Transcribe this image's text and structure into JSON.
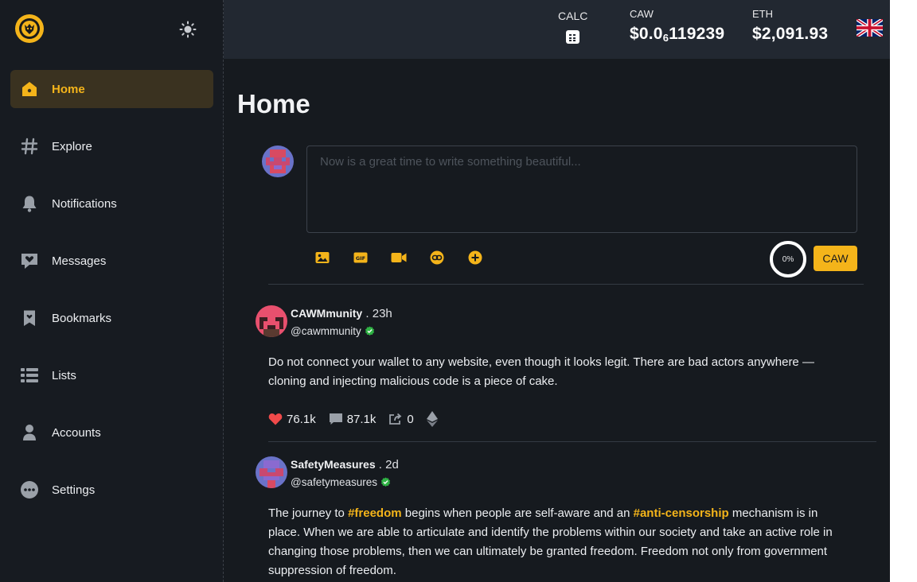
{
  "sidebar": {
    "items": [
      {
        "label": "Home",
        "icon": "home-icon",
        "active": true
      },
      {
        "label": "Explore",
        "icon": "hashtag-icon"
      },
      {
        "label": "Notifications",
        "icon": "bell-icon"
      },
      {
        "label": "Messages",
        "icon": "message-heart-icon"
      },
      {
        "label": "Bookmarks",
        "icon": "bookmark-icon"
      },
      {
        "label": "Lists",
        "icon": "list-icon"
      },
      {
        "label": "Accounts",
        "icon": "user-icon"
      },
      {
        "label": "Settings",
        "icon": "more-dots-icon"
      }
    ]
  },
  "topbar": {
    "calc_label": "CALC",
    "caw": {
      "label": "CAW",
      "prefix": "$0.0",
      "zeros": "6",
      "digits": "119239"
    },
    "eth": {
      "label": "ETH",
      "value": "$2,091.93"
    }
  },
  "main": {
    "title": "Home",
    "composer": {
      "placeholder": "Now is a great time to write something beautiful...",
      "progress": "0%",
      "submit_label": "CAW"
    }
  },
  "posts": [
    {
      "name": "CAWMmunity",
      "time": " . 23h",
      "handle": "@cawmmunity",
      "text": "Do not connect your wallet to any website, even though it looks legit. There are bad actors anywhere —cloning and injecting malicious code is a piece of cake.",
      "likes": "76.1k",
      "comments": "87.1k",
      "shares": "0"
    },
    {
      "name": "SafetyMeasures",
      "time": " . 2d",
      "handle": "@safetymeasures",
      "text_parts": [
        "The journey to ",
        "#freedom",
        " begins when people are self-aware and an ",
        "#anti-censorship",
        " mechanism is in place. When we are able to articulate and identify the problems within our society and take an active role in changing those problems, then we can ultimately be granted freedom. Freedom not only from government suppression of freedom."
      ]
    }
  ],
  "colors": {
    "accent": "#f4b41a",
    "background": "#161a1f",
    "sidebar": "#171b21",
    "topbar": "#222831",
    "like": "#f04a4a",
    "verified": "#2fb344"
  }
}
